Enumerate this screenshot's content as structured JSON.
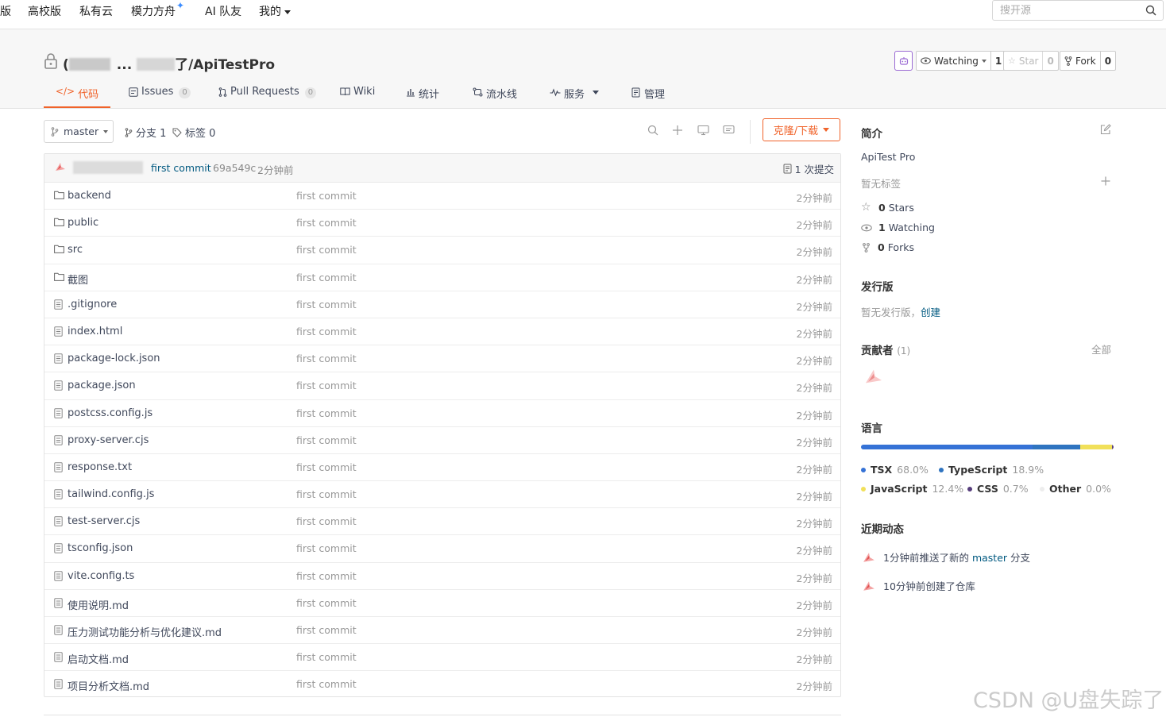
{
  "topnav": {
    "items": [
      "版",
      "高校版",
      "私有云",
      "模力方舟",
      "AI 队友",
      "我的"
    ],
    "search_placeholder": "搜开源"
  },
  "repo": {
    "title_suffix": "了/ApiTestPro",
    "visible_prefix": "(",
    "visible_ellipsis": "...",
    "watch_label": "Watching",
    "watch_count": "1",
    "star_label": "Star",
    "star_count": "0",
    "fork_label": "Fork",
    "fork_count": "0"
  },
  "tabs": [
    {
      "label": "代码",
      "badge": ""
    },
    {
      "label": "Issues",
      "badge": "0"
    },
    {
      "label": "Pull Requests",
      "badge": "0"
    },
    {
      "label": "Wiki",
      "badge": ""
    },
    {
      "label": "统计",
      "badge": ""
    },
    {
      "label": "流水线",
      "badge": ""
    },
    {
      "label": "服务",
      "badge": ""
    },
    {
      "label": "管理",
      "badge": ""
    }
  ],
  "toolbar": {
    "branch": "master",
    "branches_label": "分支 1",
    "tags_label": "标签 0",
    "clone_label": "克隆/下载"
  },
  "last_commit": {
    "message": "first commit",
    "sha": "69a549c",
    "time": "2分钟前",
    "count_label": "1 次提交"
  },
  "files": [
    {
      "name": "backend",
      "type": "dir",
      "message": "first commit",
      "time": "2分钟前"
    },
    {
      "name": "public",
      "type": "dir",
      "message": "first commit",
      "time": "2分钟前"
    },
    {
      "name": "src",
      "type": "dir",
      "message": "first commit",
      "time": "2分钟前"
    },
    {
      "name": "截图",
      "type": "dir",
      "message": "first commit",
      "time": "2分钟前"
    },
    {
      "name": ".gitignore",
      "type": "file",
      "message": "first commit",
      "time": "2分钟前"
    },
    {
      "name": "index.html",
      "type": "file",
      "message": "first commit",
      "time": "2分钟前"
    },
    {
      "name": "package-lock.json",
      "type": "file",
      "message": "first commit",
      "time": "2分钟前"
    },
    {
      "name": "package.json",
      "type": "file",
      "message": "first commit",
      "time": "2分钟前"
    },
    {
      "name": "postcss.config.js",
      "type": "file",
      "message": "first commit",
      "time": "2分钟前"
    },
    {
      "name": "proxy-server.cjs",
      "type": "file",
      "message": "first commit",
      "time": "2分钟前"
    },
    {
      "name": "response.txt",
      "type": "file",
      "message": "first commit",
      "time": "2分钟前"
    },
    {
      "name": "tailwind.config.js",
      "type": "file",
      "message": "first commit",
      "time": "2分钟前"
    },
    {
      "name": "test-server.cjs",
      "type": "file",
      "message": "first commit",
      "time": "2分钟前"
    },
    {
      "name": "tsconfig.json",
      "type": "file",
      "message": "first commit",
      "time": "2分钟前"
    },
    {
      "name": "vite.config.ts",
      "type": "file",
      "message": "first commit",
      "time": "2分钟前"
    },
    {
      "name": "使用说明.md",
      "type": "file",
      "message": "first commit",
      "time": "2分钟前"
    },
    {
      "name": "压力测试功能分析与优化建议.md",
      "type": "file",
      "message": "first commit",
      "time": "2分钟前"
    },
    {
      "name": "启动文档.md",
      "type": "file",
      "message": "first commit",
      "time": "2分钟前"
    },
    {
      "name": "项目分析文档.md",
      "type": "file",
      "message": "first commit",
      "time": "2分钟前"
    }
  ],
  "sidebar": {
    "intro_title": "简介",
    "description": "ApiTest Pro",
    "no_tags": "暂无标签",
    "stars": {
      "count": "0",
      "label": "Stars"
    },
    "watching": {
      "count": "1",
      "label": "Watching"
    },
    "forks": {
      "count": "0",
      "label": "Forks"
    },
    "releases_title": "发行版",
    "no_releases": "暂无发行版，",
    "create_link": "创建",
    "contributors_title": "贡献者",
    "contributors_count": "(1)",
    "all_link": "全部",
    "languages_title": "语言",
    "languages": [
      {
        "name": "TSX",
        "percent": "68.0%",
        "value": 68.0,
        "color": "#3572d6"
      },
      {
        "name": "TypeScript",
        "percent": "18.9%",
        "value": 18.9,
        "color": "#2f74c0"
      },
      {
        "name": "JavaScript",
        "percent": "12.4%",
        "value": 12.4,
        "color": "#f1e05a"
      },
      {
        "name": "CSS",
        "percent": "0.7%",
        "value": 0.7,
        "color": "#563d7c"
      },
      {
        "name": "Other",
        "percent": "0.0%",
        "value": 0.0,
        "color": "#ededed"
      }
    ],
    "activity_title": "近期动态",
    "activity": [
      {
        "prefix": "1分钟前推送了新的",
        "link": "master",
        "suffix": "分支"
      },
      {
        "prefix": "10分钟前创建了仓库",
        "link": "",
        "suffix": ""
      }
    ]
  },
  "watermark": "CSDN @U盘失踪了",
  "colors": {
    "accent": "#f0632a",
    "link": "#005980"
  }
}
